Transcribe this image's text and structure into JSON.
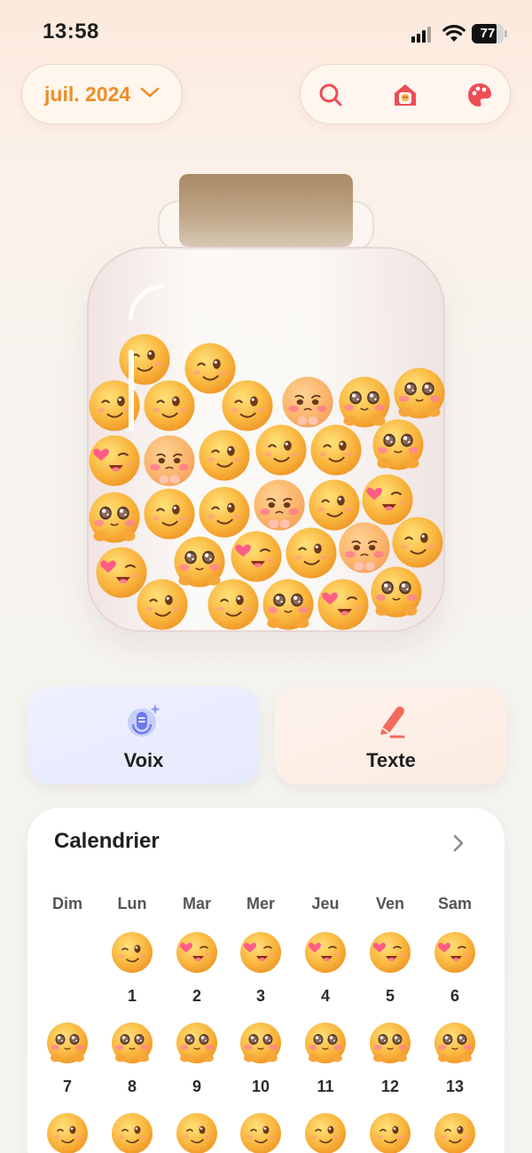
{
  "status_bar": {
    "time": "13:58",
    "battery": "77"
  },
  "header": {
    "month_label": "juil. 2024",
    "tools": [
      "search-icon",
      "home-icon",
      "palette-icon"
    ]
  },
  "jar": {
    "lid_color": "#b89c7a",
    "emoji_counts": {
      "smile": 20,
      "wink-heart": 5,
      "heart-hands": 8,
      "shy-pink": 4
    }
  },
  "actions": {
    "voice_label": "Voix",
    "text_label": "Texte"
  },
  "calendar": {
    "title": "Calendrier",
    "weekdays": [
      "Dim",
      "Lun",
      "Mar",
      "Mer",
      "Jeu",
      "Ven",
      "Sam"
    ],
    "days": [
      {
        "day": "1",
        "mood": "smile"
      },
      {
        "day": "2",
        "mood": "wink-heart"
      },
      {
        "day": "3",
        "mood": "wink-heart"
      },
      {
        "day": "4",
        "mood": "wink-heart"
      },
      {
        "day": "5",
        "mood": "wink-heart"
      },
      {
        "day": "6",
        "mood": "wink-heart"
      },
      {
        "day": "7",
        "mood": "heart-hands"
      },
      {
        "day": "8",
        "mood": "heart-hands"
      },
      {
        "day": "9",
        "mood": "heart-hands"
      },
      {
        "day": "10",
        "mood": "heart-hands"
      },
      {
        "day": "11",
        "mood": "heart-hands"
      },
      {
        "day": "12",
        "mood": "heart-hands"
      },
      {
        "day": "13",
        "mood": "heart-hands"
      },
      {
        "day": "",
        "mood": "smile"
      },
      {
        "day": "",
        "mood": "smile"
      },
      {
        "day": "",
        "mood": "smile"
      },
      {
        "day": "",
        "mood": "smile"
      },
      {
        "day": "",
        "mood": "smile"
      },
      {
        "day": "",
        "mood": "smile"
      },
      {
        "day": "",
        "mood": "smile"
      }
    ]
  },
  "colors": {
    "accent_orange": "#ef8d25",
    "icon_red": "#ee4d55",
    "voice_blue": "#6b78f0",
    "pencil_coral": "#f26a5d"
  }
}
